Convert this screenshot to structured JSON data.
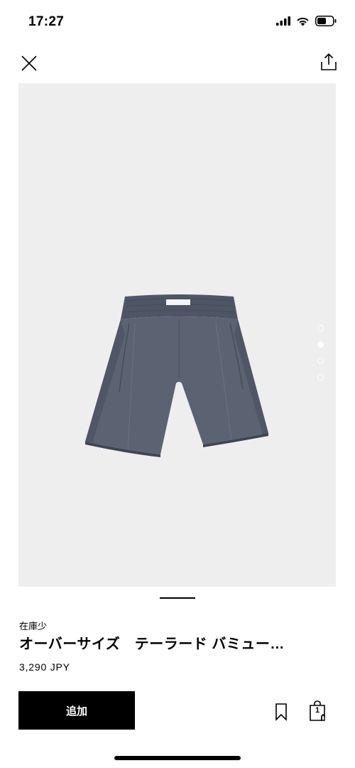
{
  "status_bar": {
    "time": "17:27",
    "icons": [
      "signal-icon",
      "wifi-icon",
      "battery-icon"
    ]
  },
  "nav": {
    "close_icon": "close-icon",
    "share_icon": "share-icon"
  },
  "gallery": {
    "image": "grey-tailored-shorts",
    "background_color": "#eeeeef",
    "dots_total": 4,
    "active_dot_index": 1
  },
  "product": {
    "stock_label": "在庫少",
    "title": "オーバーサイズ　テーラード バミュー…",
    "price": "3,290 JPY"
  },
  "actions": {
    "add_label": "追加",
    "bookmark_icon": "bookmark-icon",
    "bag_icon": "shopping-bag-icon",
    "bag_count": "1"
  },
  "colors": {
    "primary": "#000000",
    "image_background": "#eeeeef",
    "product_grey": "#5a6270"
  }
}
